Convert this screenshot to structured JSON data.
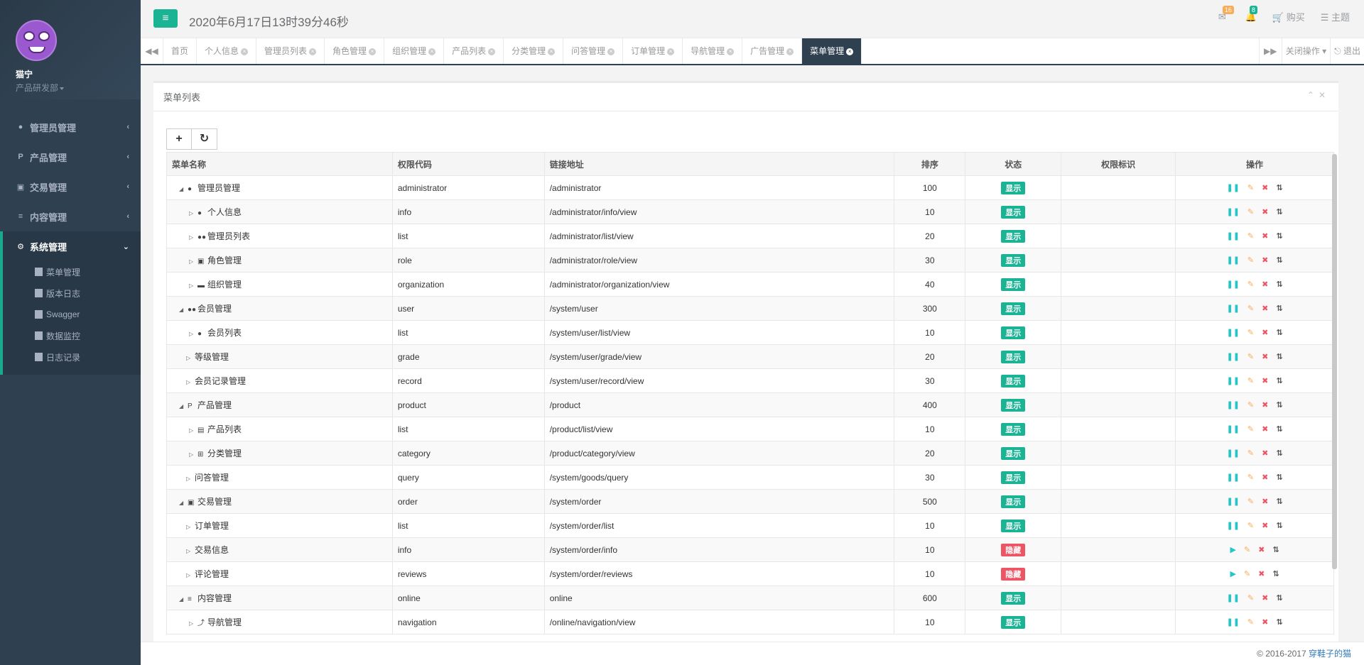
{
  "profile": {
    "name": "猫宁",
    "dept": "产品研发部"
  },
  "nav": [
    {
      "label": "管理员管理",
      "icon": "user-icon",
      "glyph": "●",
      "arrow": "‹"
    },
    {
      "label": "产品管理",
      "icon": "product-icon",
      "glyph": "P",
      "arrow": "‹"
    },
    {
      "label": "交易管理",
      "icon": "money-icon",
      "glyph": "▣",
      "arrow": "‹"
    },
    {
      "label": "内容管理",
      "icon": "list-icon",
      "glyph": "≡",
      "arrow": "‹"
    },
    {
      "label": "系统管理",
      "icon": "system-icon",
      "glyph": "⚙",
      "arrow": "⌄"
    }
  ],
  "subnav": [
    "菜单管理",
    "版本日志",
    "Swagger",
    "数据监控",
    "日志记录"
  ],
  "topbar": {
    "menu_toggle": "≡",
    "datetime": "2020年6月17日13时39分46秒",
    "mail_count": "16",
    "bell_count": "8",
    "buy": "购买",
    "theme": "主题"
  },
  "tabs": {
    "prev": "◀◀",
    "next": "▶▶",
    "items": [
      "首页",
      "个人信息",
      "管理员列表",
      "角色管理",
      "组织管理",
      "产品列表",
      "分类管理",
      "问答管理",
      "订单管理",
      "导航管理",
      "广告管理",
      "菜单管理"
    ],
    "close_ops": "关闭操作",
    "logout": "退出"
  },
  "panel": {
    "title": "菜单列表"
  },
  "table": {
    "headers": [
      "菜单名称",
      "权限代码",
      "链接地址",
      "排序",
      "状态",
      "权限标识",
      "操作"
    ],
    "rows": [
      {
        "level": 0,
        "name": "管理员管理",
        "icon": "●",
        "code": "administrator",
        "url": "/administrator",
        "sort": "100",
        "status": "显示"
      },
      {
        "level": 1,
        "name": "个人信息",
        "icon": "●",
        "code": "info",
        "url": "/administrator/info/view",
        "sort": "10",
        "status": "显示"
      },
      {
        "level": 1,
        "name": "管理员列表",
        "icon": "●●",
        "code": "list",
        "url": "/administrator/list/view",
        "sort": "20",
        "status": "显示"
      },
      {
        "level": 1,
        "name": "角色管理",
        "icon": "▣",
        "code": "role",
        "url": "/administrator/role/view",
        "sort": "30",
        "status": "显示"
      },
      {
        "level": 1,
        "name": "组织管理",
        "icon": "▬",
        "code": "organization",
        "url": "/administrator/organization/view",
        "sort": "40",
        "status": "显示"
      },
      {
        "level": 0,
        "name": "会员管理",
        "icon": "●●",
        "code": "user",
        "url": "/system/user",
        "sort": "300",
        "status": "显示"
      },
      {
        "level": 1,
        "name": "会员列表",
        "icon": "●",
        "code": "list",
        "url": "/system/user/list/view",
        "sort": "10",
        "status": "显示"
      },
      {
        "level": 1,
        "name": "等级管理",
        "icon": "",
        "code": "grade",
        "url": "/system/user/grade/view",
        "sort": "20",
        "status": "显示"
      },
      {
        "level": 1,
        "name": "会员记录管理",
        "icon": "",
        "code": "record",
        "url": "/system/user/record/view",
        "sort": "30",
        "status": "显示"
      },
      {
        "level": 0,
        "name": "产品管理",
        "icon": "P",
        "code": "product",
        "url": "/product",
        "sort": "400",
        "status": "显示"
      },
      {
        "level": 1,
        "name": "产品列表",
        "icon": "▤",
        "code": "list",
        "url": "/product/list/view",
        "sort": "10",
        "status": "显示"
      },
      {
        "level": 1,
        "name": "分类管理",
        "icon": "⊞",
        "code": "category",
        "url": "/product/category/view",
        "sort": "20",
        "status": "显示"
      },
      {
        "level": 1,
        "name": "问答管理",
        "icon": "",
        "code": "query",
        "url": "/system/goods/query",
        "sort": "30",
        "status": "显示"
      },
      {
        "level": 0,
        "name": "交易管理",
        "icon": "▣",
        "code": "order",
        "url": "/system/order",
        "sort": "500",
        "status": "显示"
      },
      {
        "level": 1,
        "name": "订单管理",
        "icon": "",
        "code": "list",
        "url": "/system/order/list",
        "sort": "10",
        "status": "显示"
      },
      {
        "level": 1,
        "name": "交易信息",
        "icon": "",
        "code": "info",
        "url": "/system/order/info",
        "sort": "10",
        "status": "隐藏"
      },
      {
        "level": 1,
        "name": "评论管理",
        "icon": "",
        "code": "reviews",
        "url": "/system/order/reviews",
        "sort": "10",
        "status": "隐藏"
      },
      {
        "level": 0,
        "name": "内容管理",
        "icon": "≡",
        "code": "online",
        "url": "online",
        "sort": "600",
        "status": "显示"
      },
      {
        "level": 1,
        "name": "导航管理",
        "icon": "⤴",
        "code": "navigation",
        "url": "/online/navigation/view",
        "sort": "10",
        "status": "显示"
      }
    ]
  },
  "ops": {
    "pause": "❚❚",
    "play": "▶",
    "edit": "✎",
    "delete": "✖",
    "sort": "⇅"
  },
  "footer": {
    "copyright": "© 2016-2017",
    "author": "穿鞋子的猫"
  },
  "colors": {
    "accent": "#1ab394",
    "sidebar": "#2f4050",
    "danger": "#ed5565",
    "warning": "#f8ac59",
    "info": "#23c6c8"
  }
}
